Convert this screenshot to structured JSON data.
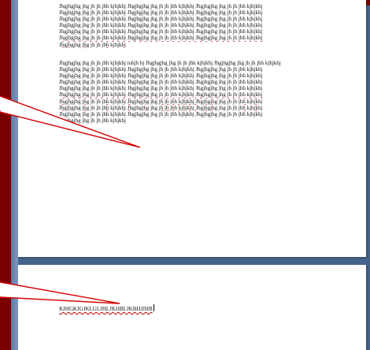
{
  "document": {
    "page1": {
      "paragraph1": [
        "Jhgjhgjhg jhg jh jh jhh kjhjkhj Jhgjhgjhg jhg jh jh jhh kjhjkhj Jhgjhgjhg jhg jh jh jhh kjhjkhj",
        "Jhgjhgjhg jhg jh jh jhh kjhjkhj Jhgjhgjhg jhg jh jh jhh kjhjkhj Jhgjhgjhg jhg jh jh jhh kjhjkhj",
        "Jhgjhgjhg jhg jh jh jhh kjhjkhj Jhgjhgjhg jhg jh jh jhh kjhjkhj Jhgjhgjhg jhg jh jh jhh kjhjkhj",
        "Jhgjhgjhg jhg jh jh jhh kjhjkhj Jhgjhgjhg jhg jh jh jhh kjhjkhj Jhgjhgjhg jhg jh jh jhh kjhjkhj",
        "Jhgjhgjhg jhg jh jh jhh kjhjkhj Jhgjhgjhg jhg jh jh jhh kjhjkhj Jhgjhgjhg jhg jh jh jhh kjhjkhj",
        "Jhgjhgjhg jhg jh jh jhh kjhjkhj Jhgjhgjhg jhg jh jh jhh kjhjkhj Jhgjhgjhg jhg jh jh jhh kjhjkhj",
        "Jhgjhgjhg jhg jh jh jhh kjhjkhj"
      ],
      "paragraph2": [
        "Jhgjhgjhg jhg jh jh jhh kjhjkhj iuhjh hj Jhgjhgjhg jhg jh jh jhh kjhjkhj Jhgjhgjhg jhg jh jh jhh kjhjkhj",
        "Jhgjhgjhg jhg jh jh jhh kjhjkhj Jhgjhgjhg jhg jh jh jhh kjhjkhj Jhgjhgjhg jhg jh jh jhh kjhjkhj",
        "Jhgjhgjhg jhg jh jh jhh kjhjkhj Jhgjhgjhg jhg jh jh jhh kjhjkhj Jhgjhgjhg jhg jh jh jhh kjhjkhj",
        "Jhgjhgjhg jhg jh jh jhh kjhjkhj Jhgjhgjhg jhg jh jh jhh kjhjkhj Jhgjhgjhg jhg jh jh jhh kjhjkhj",
        "Jhgjhgjhg jhg jh jh jhh kjhjkhj Jhgjhgjhg jhg jh jh jhh kjhjkhj Jhgjhgjhg jhg jh jh jhh kjhjkhj",
        "Jhgjhgjhg jhg jh jh jhh kjhjkhj Jhgjhgjhg jhg jh jh jhh kjhjkhj Jhgjhgjhg jhg jh jh jhh kjhjkhj",
        "Jhgjhgjhg jhg jh jh jhh kjhjkhj Jhgjhgjhg jhg jh jh jhh kjhjkhj Jhgjhgjhg jhg jh jh jhh kjhjkhj",
        "Jhgjhgjhg jhg jh jh jhh kjhjkhj Jhgjhgjhg jhg jh jh jhh kjhjkhj Jhgjhgjhg jhg jh jh jhh kjhjkhj",
        "Jhgjhgjhg jhg jh jh jhh kjhjkhj Jhgjhgjhg jhg jh jh jhh kjhjkhj Jhgjhgjhg jhg jh jh jhh kjhjkhj",
        "Jhgjhgjhg jhg jh jh jhh kjhjkhj"
      ]
    },
    "page2": {
      "text": "KJHGKJGJKLGLJHLJKHBLJKBHJJHB"
    }
  },
  "colors": {
    "workspace": "#46638b",
    "left_bar": "#7a0000",
    "callout_line": "#d40000",
    "spell_underline": "#c00000"
  }
}
